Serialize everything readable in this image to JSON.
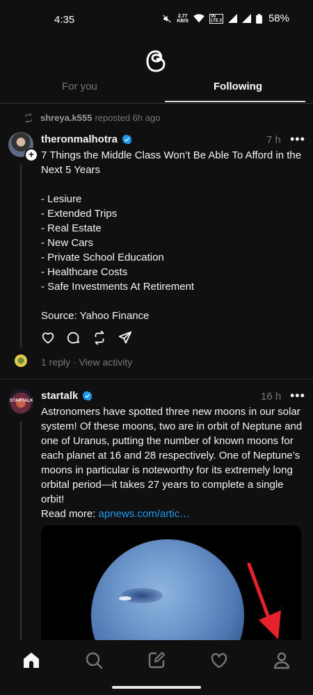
{
  "status_bar": {
    "time": "4:35",
    "net_speed_value": "2.77",
    "net_speed_unit": "KB/S",
    "network_label_top": "Vo",
    "network_label_bottom": "LTE 2",
    "battery": "58%"
  },
  "tabs": [
    {
      "label": "For you",
      "active": false
    },
    {
      "label": "Following",
      "active": true
    }
  ],
  "repost": {
    "username": "shreya.k555",
    "text": "reposted 6h ago"
  },
  "posts": [
    {
      "username": "theronmalhotra",
      "verified": true,
      "time": "7 h",
      "more": "•••",
      "body": "7 Things the Middle Class Won’t Be Able To Afford in the Next 5 Years\n\n- Lesiure\n- Extended Trips\n- Real Estate\n- New Cars\n- Private School Education\n- Healthcare Costs\n- Safe Investments At Retirement\n\nSource: Yahoo Finance",
      "reply_meta": "1 reply · View activity"
    },
    {
      "username": "startalk",
      "avatar_text": "STARTALK",
      "verified": true,
      "time": "16 h",
      "more": "•••",
      "body": "Astronomers have spotted three new moons in our solar system! Of these moons, two are in orbit of Neptune and one of Uranus, putting the number of known moons for each planet at 16 and 28 respectively. One of Neptune’s moons in particular is noteworthy for its extremely long orbital period—it takes 27 years to complete a single orbit!",
      "read_more_label": "Read more: ",
      "read_more_link": "apnews.com/artic…"
    }
  ],
  "colors": {
    "background": "#101010",
    "text": "#f3f5f7",
    "muted": "#777777",
    "verified": "#1d9bf0",
    "arrow": "#e8222b"
  },
  "bottom_nav": [
    "home-icon",
    "search-icon",
    "compose-icon",
    "heart-icon",
    "profile-icon"
  ]
}
